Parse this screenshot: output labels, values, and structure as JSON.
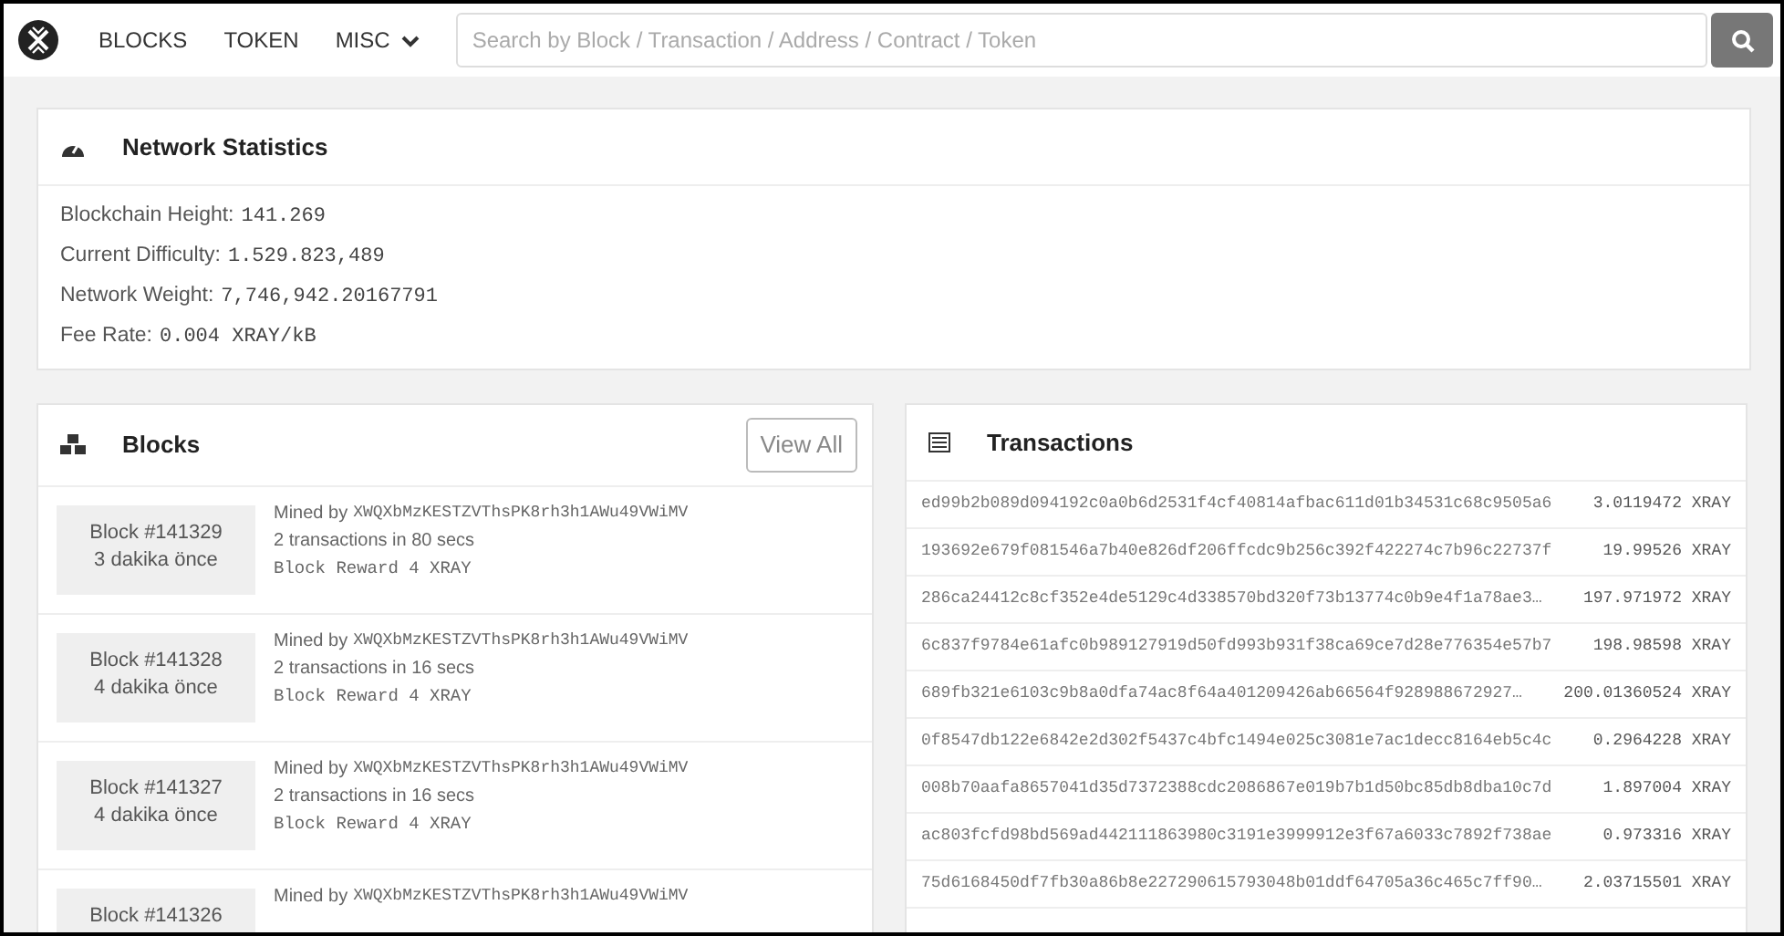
{
  "nav": {
    "items": [
      {
        "label": "BLOCKS",
        "dropdown": false
      },
      {
        "label": "TOKEN",
        "dropdown": false
      },
      {
        "label": "MISC",
        "dropdown": true
      }
    ],
    "search": {
      "placeholder": "Search by Block / Transaction / Address / Contract / Token"
    }
  },
  "network_statistics": {
    "title": "Network Statistics",
    "stats": [
      {
        "label": "Blockchain Height:",
        "value": "141.269"
      },
      {
        "label": "Current Difficulty:",
        "value": "1.529.823,489"
      },
      {
        "label": "Network Weight:",
        "value": "7,746,942.20167791"
      },
      {
        "label": "Fee Rate:",
        "value": "0.004 XRAY/kB"
      }
    ]
  },
  "blocks": {
    "title": "Blocks",
    "button": "View All",
    "items": [
      {
        "block": "Block #141329",
        "time": "3 dakika önce",
        "mined_by": "Mined by",
        "miner": "XWQXbMzKESTZVThsPK8rh3h1AWu49VWiMV",
        "transactions": "2 transactions in 80 secs",
        "reward": "Block Reward 4 XRAY"
      },
      {
        "block": "Block #141328",
        "time": "4 dakika önce",
        "mined_by": "Mined by",
        "miner": "XWQXbMzKESTZVThsPK8rh3h1AWu49VWiMV",
        "transactions": "2 transactions in 16 secs",
        "reward": "Block Reward 4 XRAY"
      },
      {
        "block": "Block #141327",
        "time": "4 dakika önce",
        "mined_by": "Mined by",
        "miner": "XWQXbMzKESTZVThsPK8rh3h1AWu49VWiMV",
        "transactions": "2 transactions in 16 secs",
        "reward": "Block Reward 4 XRAY"
      },
      {
        "block": "Block #141326",
        "mined_by": "Mined by",
        "miner": "XWQXbMzKESTZVThsPK8rh3h1AWu49VWiMV"
      }
    ]
  },
  "transactions": {
    "title": "Transactions",
    "rows": [
      {
        "hash": "ed99b2b089d094192c0a0b6d2531f4cf40814afbac611d01b34531c68c9505a6",
        "amount": "3.0119472 XRAY"
      },
      {
        "hash": "193692e679f081546a7b40e826df206ffcdc9b256c392f422274c7b96c22737f",
        "amount": "19.99526 XRAY"
      },
      {
        "hash": "286ca24412c8cf352e4de5129c4d338570bd320f73b13774c0b9e4f1a78ae3…",
        "amount": "197.971972 XRAY"
      },
      {
        "hash": "6c837f9784e61afc0b989127919d50fd993b931f38ca69ce7d28e776354e57b7",
        "amount": "198.98598 XRAY"
      },
      {
        "hash": "689fb321e6103c9b8a0dfa74ac8f64a401209426ab66564f928988672927…",
        "amount": "200.01360524 XRAY"
      },
      {
        "hash": "0f8547db122e6842e2d302f5437c4bfc1494e025c3081e7ac1decc8164eb5c4c",
        "amount": "0.2964228 XRAY"
      },
      {
        "hash": "008b70aafa8657041d35d7372388cdc2086867e019b7b1d50bc85db8dba10c7d",
        "amount": "1.897004 XRAY"
      },
      {
        "hash": "ac803fcfd98bd569ad442111863980c3191e3999912e3f67a6033c7892f738ae",
        "amount": "0.973316 XRAY"
      },
      {
        "hash": "75d6168450df7fb30a86b8e227290615793048b01ddf64705a36c465c7ff90…",
        "amount": "2.03715501 XRAY"
      }
    ]
  }
}
